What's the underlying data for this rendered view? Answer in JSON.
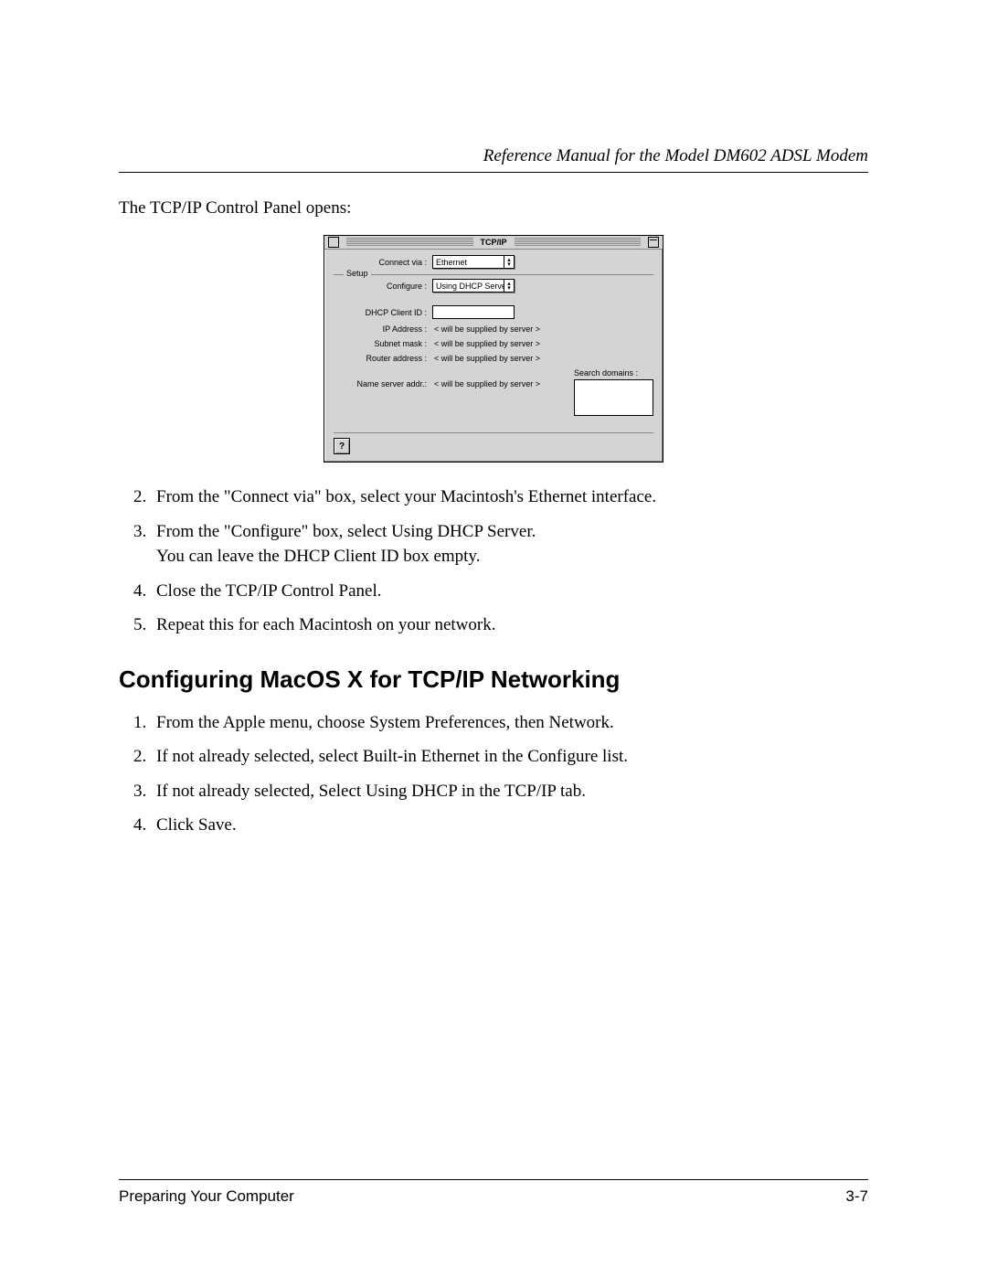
{
  "header": {
    "manual_title": "Reference Manual for the Model DM602 ADSL Modem"
  },
  "intro_text": "The TCP/IP Control Panel opens:",
  "tcpip_panel": {
    "title": "TCP/IP",
    "connect_via_label": "Connect via :",
    "connect_via_value": "Ethernet",
    "setup_label": "Setup",
    "configure_label": "Configure :",
    "configure_value": "Using DHCP Server",
    "dhcp_client_id_label": "DHCP Client ID :",
    "ip_address_label": "IP Address :",
    "subnet_mask_label": "Subnet mask :",
    "router_address_label": "Router address :",
    "name_server_label": "Name server addr.:",
    "supplied_text": "< will be supplied by server >",
    "search_domains_label": "Search domains :",
    "help_button": "?"
  },
  "steps_first": [
    "From the \"Connect via\" box, select your Macintosh's Ethernet interface.",
    "From the \"Configure\" box, select Using DHCP Server.\nYou can leave the DHCP Client ID box empty.",
    "Close the TCP/IP Control Panel.",
    "Repeat this for each Macintosh on your network."
  ],
  "section_heading": "Configuring MacOS X for TCP/IP Networking",
  "steps_second": [
    "From the Apple menu, choose System Preferences, then Network.",
    "If not already selected, select Built-in Ethernet in the Configure list.",
    "If not already selected, Select Using DHCP in the TCP/IP tab.",
    "Click Save."
  ],
  "footer": {
    "chapter": "Preparing Your Computer",
    "page_number": "3-7"
  }
}
